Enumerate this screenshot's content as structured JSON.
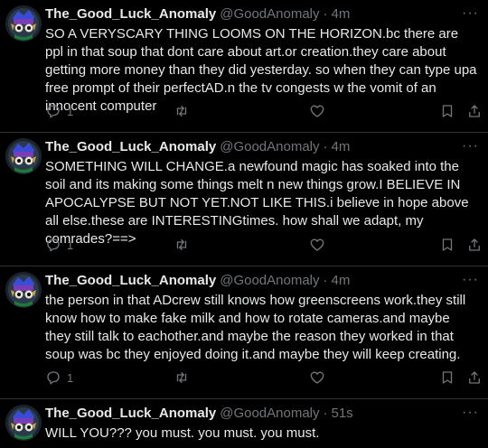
{
  "tweets": [
    {
      "name": "The_Good_Luck_Anomaly",
      "handle": "@GoodAnomaly",
      "separator": "·",
      "time": "4m",
      "more": "···",
      "text": "SO A VERYSCARY THING LOOMS ON THE HORIZON.bc there are ppl in that soup that dont care about art.or creation.they care about getting more money than they did yesterday. so when they can type upa free prompt of their perfectAD.n the tv congests w the vomit of an innocent computer",
      "reply_count": "1"
    },
    {
      "name": "The_Good_Luck_Anomaly",
      "handle": "@GoodAnomaly",
      "separator": "·",
      "time": "4m",
      "more": "···",
      "text": "SOMETHING WILL CHANGE.a newfound magic has soaked into the soil and its making some things melt n new things grow.I BELIEVE IN APOCALYPSE BUT NOT YET.NOT LIKE THIS.i believe in hope above all else.these are INTERESTINGtimes. how shall we adapt, my comrades?==>",
      "reply_count": "1"
    },
    {
      "name": "The_Good_Luck_Anomaly",
      "handle": "@GoodAnomaly",
      "separator": "·",
      "time": "4m",
      "more": "···",
      "text": "the person in that ADcrew still knows how greenscreens work.they still know how to make fake milk and how to rotate cameras.and maybe they still talk to eachother.and maybe the reason they worked in that soup was bc they enjoyed doing it.and maybe they will keep creating.",
      "reply_count": "1"
    },
    {
      "name": "The_Good_Luck_Anomaly",
      "handle": "@GoodAnomaly",
      "separator": "·",
      "time": "51s",
      "more": "···",
      "text": "WILL YOU??? you must. you must. you must."
    }
  ],
  "icons": {
    "reply": "reply-icon",
    "retweet": "retweet-icon",
    "like": "heart-icon",
    "bookmark": "bookmark-icon",
    "share": "share-icon"
  },
  "colors": {
    "background": "#000000",
    "text": "#e7e9ea",
    "muted": "#71767b",
    "divider": "#2f3336"
  }
}
